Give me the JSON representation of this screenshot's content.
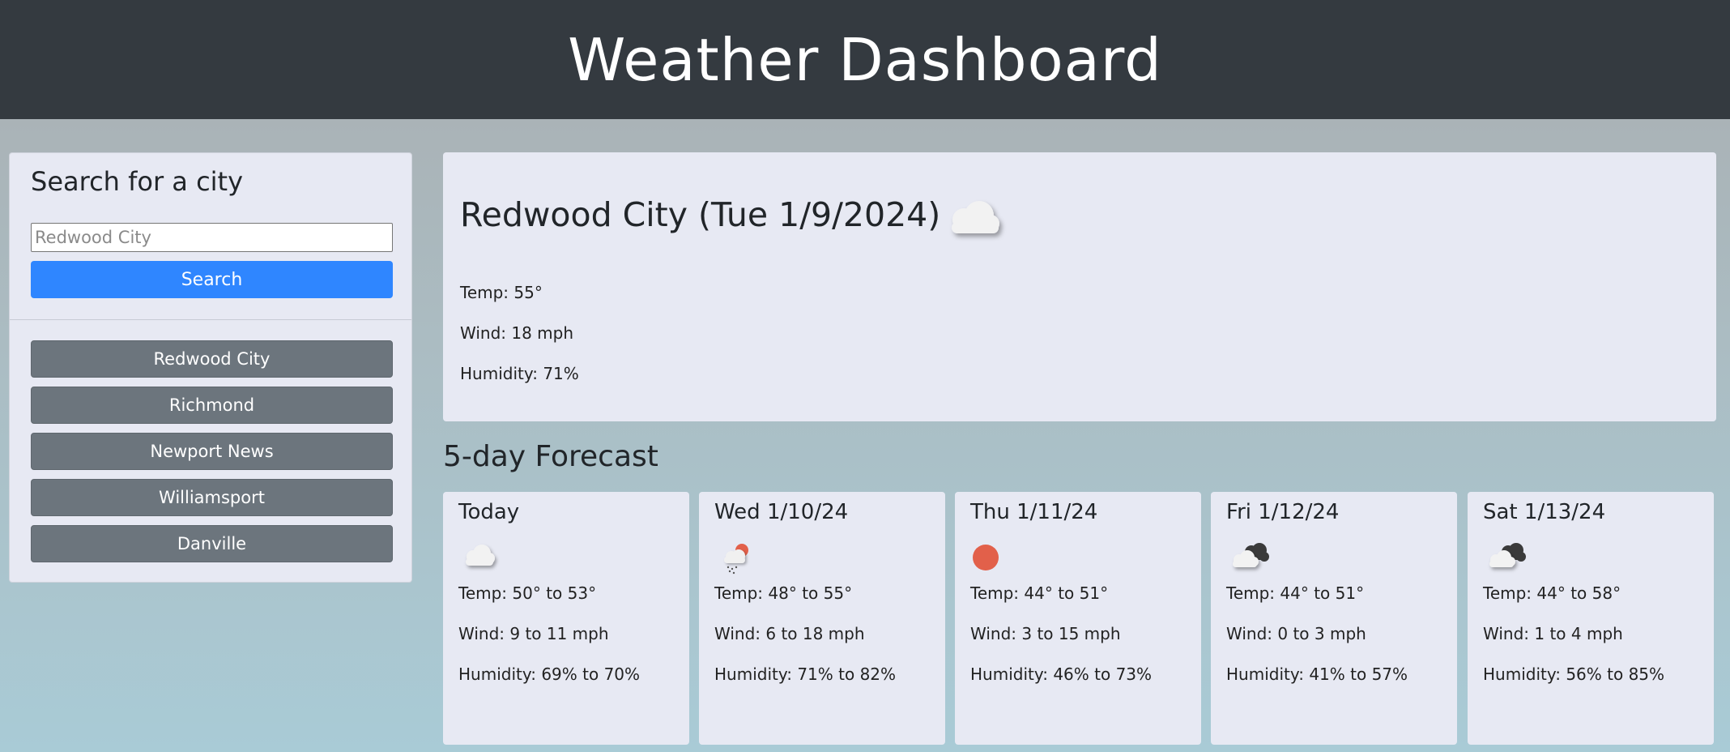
{
  "header": {
    "title": "Weather Dashboard"
  },
  "sidebar": {
    "heading": "Search for a city",
    "search_placeholder": "Redwood City",
    "search_button": "Search",
    "history": [
      "Redwood City",
      "Richmond",
      "Newport News",
      "Williamsport",
      "Danville"
    ]
  },
  "current": {
    "title": "Redwood City (Tue 1/9/2024)",
    "icon": "cloud-icon",
    "temp": "Temp: 55°",
    "wind": "Wind: 18 mph",
    "humidity": "Humidity: 71%"
  },
  "forecast": {
    "title": "5-day Forecast",
    "days": [
      {
        "day": "Today",
        "icon": "cloud-icon",
        "temp": "Temp: 50° to 53°",
        "wind": "Wind: 9 to 11 mph",
        "humidity": "Humidity: 69% to 70%"
      },
      {
        "day": "Wed 1/10/24",
        "icon": "sun-rain-cloud-icon",
        "temp": "Temp: 48° to 55°",
        "wind": "Wind: 6 to 18 mph",
        "humidity": "Humidity: 71% to 82%"
      },
      {
        "day": "Thu 1/11/24",
        "icon": "sun-icon",
        "temp": "Temp: 44° to 51°",
        "wind": "Wind: 3 to 15 mph",
        "humidity": "Humidity: 46% to 73%"
      },
      {
        "day": "Fri 1/12/24",
        "icon": "broken-clouds-icon",
        "temp": "Temp: 44° to 51°",
        "wind": "Wind: 0 to 3 mph",
        "humidity": "Humidity: 41% to 57%"
      },
      {
        "day": "Sat 1/13/24",
        "icon": "broken-clouds-icon",
        "temp": "Temp: 44° to 58°",
        "wind": "Wind: 1 to 4 mph",
        "humidity": "Humidity: 56% to 85%"
      }
    ]
  },
  "colors": {
    "header_bg": "#343a40",
    "card_bg": "#e7e9f3",
    "primary_button": "#2f86ff",
    "history_button": "#6c757d",
    "sun": "#e2604a"
  }
}
